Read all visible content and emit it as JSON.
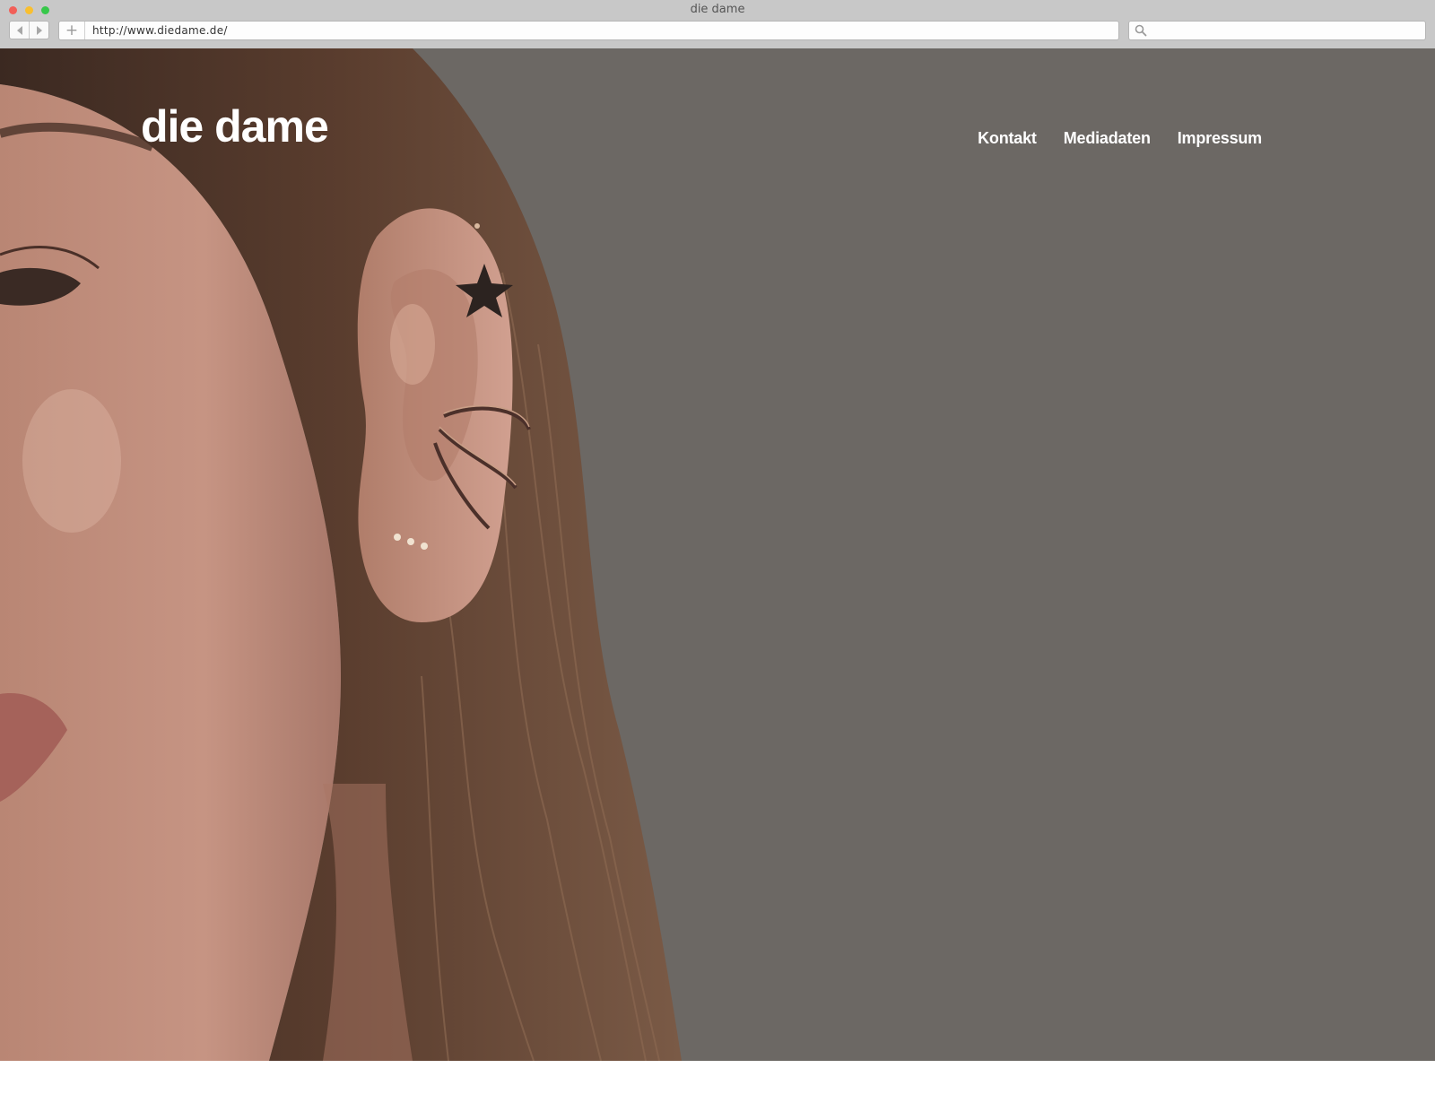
{
  "browser": {
    "window_title": "die dame",
    "url": "http://www.diedame.de/",
    "search_placeholder": ""
  },
  "site": {
    "logo": "die dame",
    "nav": {
      "kontakt": "Kontakt",
      "mediadaten": "Mediadaten",
      "impressum": "Impressum"
    }
  },
  "colors": {
    "background": "#6c6864",
    "text": "#ffffff",
    "chrome": "#c8c8c8"
  }
}
